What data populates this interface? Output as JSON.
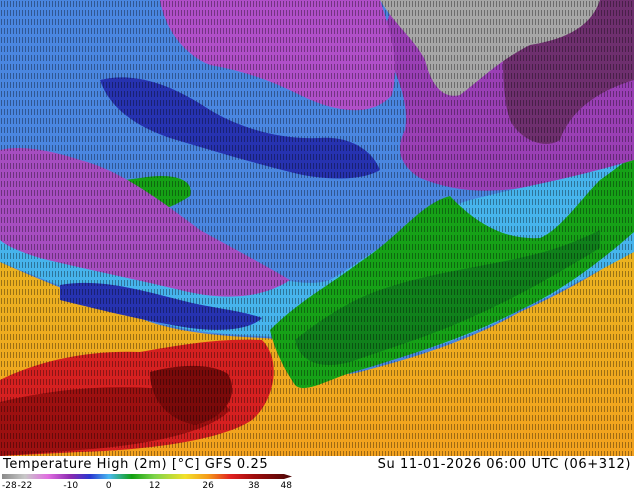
{
  "map": {
    "title": "Temperature High (2m) [°C] GFS 0.25",
    "valid_time": "Su 11-01-2026 06:00 UTC (06+312)",
    "colors": {
      "grey": "#9a9a9a",
      "dark_purple": "#6b2f6b",
      "purple": "#9a3aa8",
      "violet": "#b04fd0",
      "blue": "#3a5fd0",
      "dark_blue": "#1e2ea8",
      "cyan": "#46a0e6",
      "green": "#1fa31f",
      "dark_green": "#117a1f",
      "yellow": "#e9c21a",
      "orange": "#f0a021",
      "red": "#d21f1f",
      "dark_red": "#9a0f0f"
    }
  },
  "legend": {
    "ticks": [
      "-28",
      "-22",
      "-10",
      "0",
      "12",
      "26",
      "38",
      "48"
    ],
    "stops": [
      {
        "value": -28,
        "color": "#8a8a8a"
      },
      {
        "value": -22,
        "color": "#c8c8c8"
      },
      {
        "value": -16,
        "color": "#e06ee0"
      },
      {
        "value": -10,
        "color": "#8a2ab0"
      },
      {
        "value": -5,
        "color": "#2a36d0"
      },
      {
        "value": 0,
        "color": "#49b8f0"
      },
      {
        "value": 6,
        "color": "#12a012"
      },
      {
        "value": 12,
        "color": "#7ed44a"
      },
      {
        "value": 20,
        "color": "#f2e12a"
      },
      {
        "value": 26,
        "color": "#f59a1a"
      },
      {
        "value": 32,
        "color": "#e02020"
      },
      {
        "value": 38,
        "color": "#a00c0c"
      },
      {
        "value": 48,
        "color": "#4a0606"
      }
    ]
  }
}
